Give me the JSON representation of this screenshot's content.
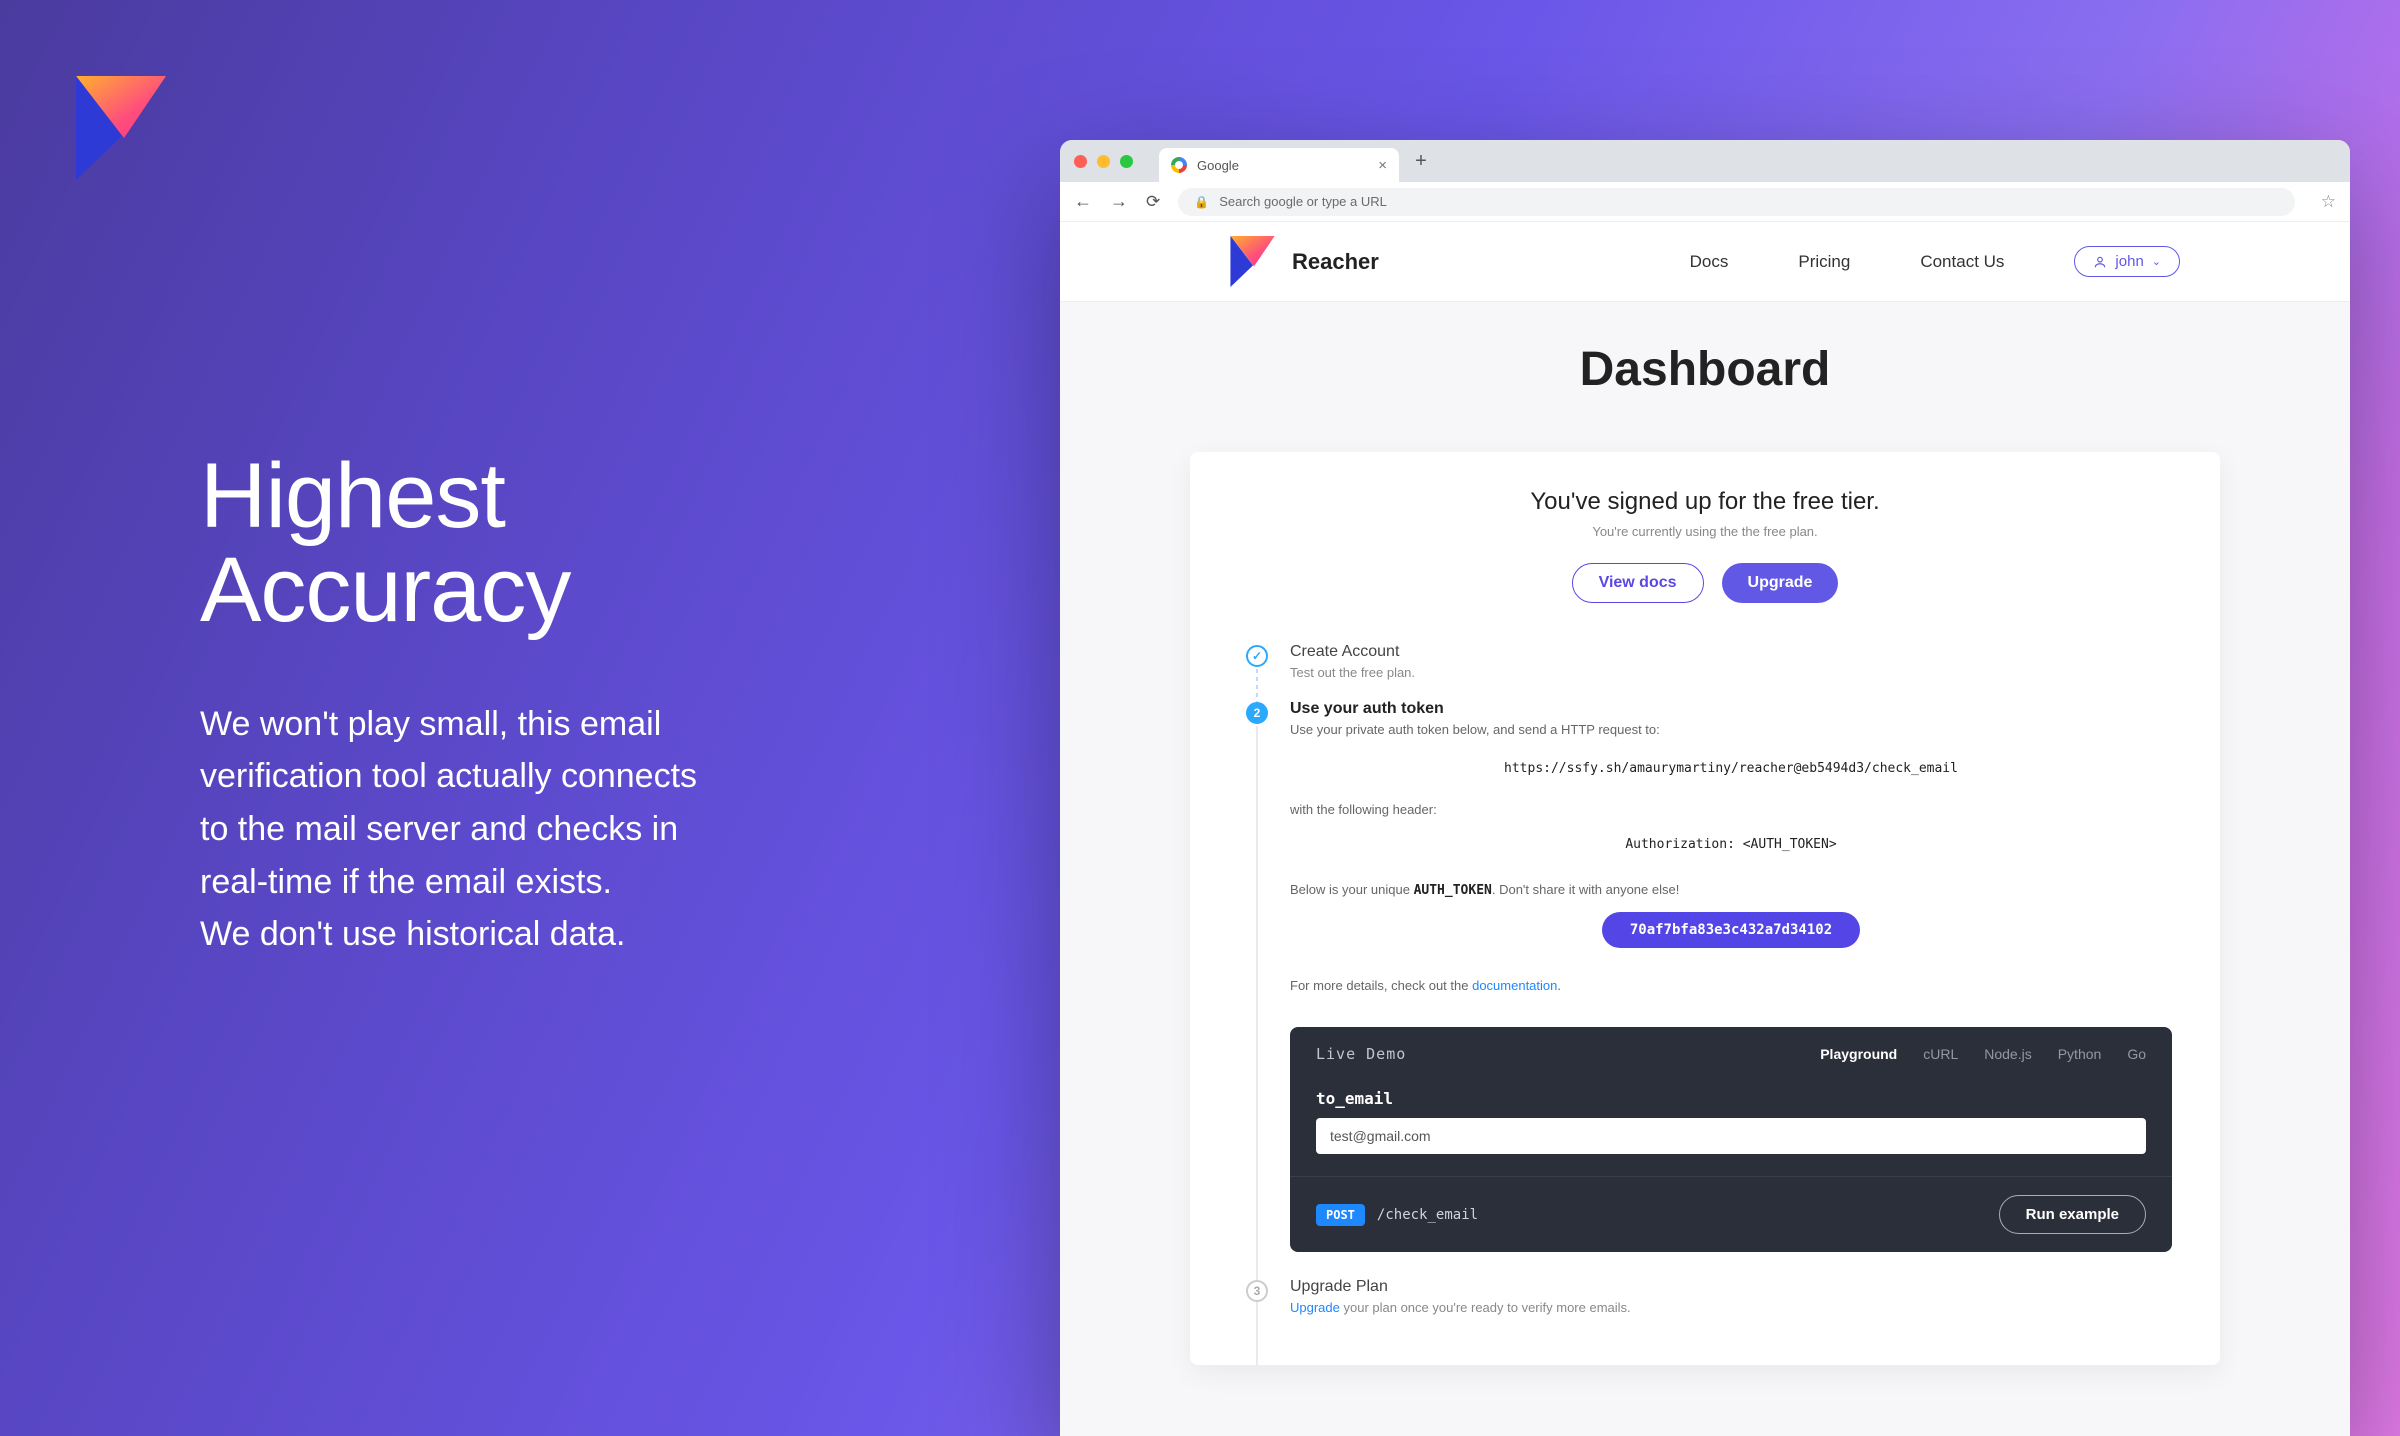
{
  "hero": {
    "title_line1": "Highest",
    "title_line2": "Accuracy",
    "body_line1": "We won't play small, this email",
    "body_line2": "verification tool actually connects",
    "body_line3": "to the mail server and checks in",
    "body_line4": "real-time if the email exists.",
    "body_line5": "We don't use historical data."
  },
  "browser": {
    "tab_title": "Google",
    "address_placeholder": "Search google or type a URL"
  },
  "nav": {
    "brand": "Reacher",
    "links": [
      "Docs",
      "Pricing",
      "Contact Us"
    ],
    "user": "john"
  },
  "page_title": "Dashboard",
  "card": {
    "heading": "You've signed up for the free tier.",
    "sub": "You're currently using the the free plan.",
    "view_docs": "View docs",
    "upgrade": "Upgrade"
  },
  "steps": {
    "s1_title": "Create Account",
    "s1_sub": "Test out the free plan.",
    "s2_num": "2",
    "s2_title": "Use your auth token",
    "s2_line1": "Use your private auth token below, and send a HTTP request to:",
    "s2_url": "https://ssfy.sh/amaurymartiny/reacher@eb5494d3/check_email",
    "s2_line2": "with the following header:",
    "s2_header": "Authorization: <AUTH_TOKEN>",
    "s2_line3a": "Below is your unique ",
    "s2_line3b": "AUTH_TOKEN",
    "s2_line3c": ". Don't share it with anyone else!",
    "s2_token": "70af7bfa83e3c432a7d34102",
    "s2_more_a": "For more details, check out the ",
    "s2_more_link": "documentation",
    "s3_num": "3",
    "s3_title": "Upgrade Plan",
    "s3_sub_a": "Upgrade",
    "s3_sub_b": " your plan once you're ready to verify more emails."
  },
  "demo": {
    "title": "Live Demo",
    "tabs": [
      "Playground",
      "cURL",
      "Node.js",
      "Python",
      "Go"
    ],
    "label": "to_email",
    "input_value": "test@gmail.com",
    "method": "POST",
    "endpoint": "/check_email",
    "run": "Run example"
  }
}
